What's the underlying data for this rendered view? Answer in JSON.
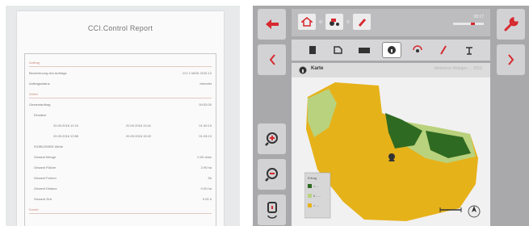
{
  "report": {
    "title": "CCI.Control Report",
    "rows": [
      {
        "key": "Auftrag",
        "section": true
      },
      {
        "key": "Bezeichnung des Auftrags",
        "value": "CCI 1 MOD 2016 12"
      },
      {
        "key": "Auftragsstatus",
        "value": "beendet"
      },
      {
        "key": "Zeiten",
        "section": true
      },
      {
        "key": "Gesamtauftrag",
        "value": "00:52:00"
      },
      {
        "key": "Einsätze",
        "indent": 1
      },
      {
        "key": "20.09.2016 12:10",
        "date": "20.09.2016 13:41",
        "value": "01:30:19",
        "indent": 2
      },
      {
        "key": "20.09.2016 13:56",
        "date": "20.09.2016 15:22",
        "value": "01:26:13",
        "indent": 2
      },
      {
        "key": "ISOBUS/NBS Werte",
        "indent": 1
      },
      {
        "key": "Gesamt Menge",
        "value": "0.00 dose",
        "indent": 1
      },
      {
        "key": "Gesamt Fläche",
        "value": "2.95 ha",
        "indent": 1
      },
      {
        "key": "Gesamt Fahren",
        "value": "5h",
        "indent": 1
      },
      {
        "key": "Gesamt Distanz",
        "value": "0.00 ha",
        "indent": 1
      },
      {
        "key": "Gesamt Zeit",
        "value": "0.00 h",
        "indent": 1
      },
      {
        "key": "Kunde",
        "section": true
      }
    ]
  },
  "terminal": {
    "map_label": "Karte",
    "map_status": "Aktivieren Ablagen ... 2016",
    "clock": "08:17",
    "legend": [
      "Ertrag",
      "> ...",
      "0 - ...",
      "< ..."
    ],
    "colors": {
      "field_yellow": "#e6b21a",
      "field_light_green": "#b9d27e",
      "field_dark_green": "#2f6a22",
      "accent_red": "#d7282f",
      "frame_grey": "#a9a9ab"
    },
    "icons": {
      "left": [
        "back-arrow-icon",
        "previous-icon",
        "zoom-in-icon",
        "zoom-out-icon",
        "reset-view-icon"
      ],
      "right": [
        "wrench-icon",
        "next-icon"
      ],
      "top": [
        "home-icon",
        "tractor-icon",
        "pen-icon"
      ],
      "tabs": [
        "task-icon",
        "document-icon",
        "field-icon",
        "info-icon",
        "spray-icon",
        "edit-icon",
        "settings-icon"
      ]
    }
  }
}
